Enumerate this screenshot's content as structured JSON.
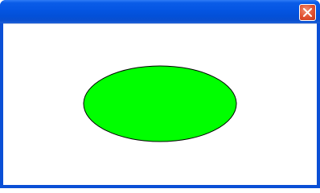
{
  "window": {
    "title": ""
  },
  "titlebar": {
    "close_icon": "close-icon"
  },
  "drawing": {
    "shape": "ellipse",
    "fill_color": "#00ff00",
    "stroke_color": "#000000"
  },
  "colors": {
    "titlebar": "#0556e3",
    "close_button": "#e0502f",
    "client_background": "#ffffff"
  }
}
